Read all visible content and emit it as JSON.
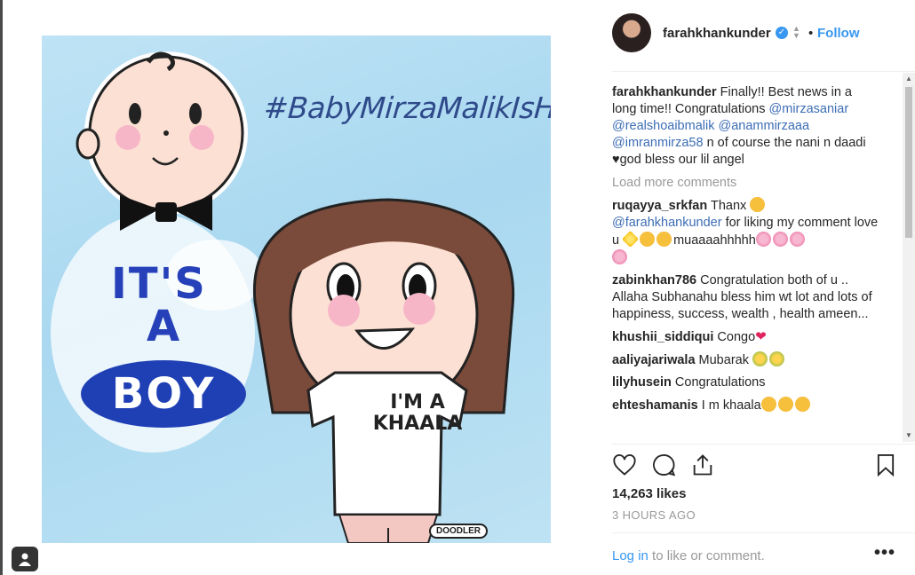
{
  "post": {
    "hashtag_art_text": "#BabyMirzaMalikIsHere",
    "art_its": "IT'S",
    "art_a": "A",
    "art_boy": "BOY",
    "art_shirt": "I'M A KHAALA",
    "art_signature": "DOODLER"
  },
  "header": {
    "username": "farahkhankunder",
    "follow_label": "Follow",
    "separator": "•"
  },
  "caption": {
    "username": "farahkhankunder",
    "text": " Finally!! Best news in a long time!! Congratulations ",
    "mention1": "@mirzasaniar",
    "sp1": " ",
    "mention2": "@realshoaibmalik",
    "sp2": " ",
    "mention3": "@anammirzaaa",
    "sp3": " ",
    "mention4": "@imranmirza58",
    "text2": " n of course the nani n daadi ",
    "heart": "♥",
    "text3": "god bless our lil angel"
  },
  "load_more": "Load more comments",
  "comments": [
    {
      "user": "ruqayya_srkfan",
      "text": " Thanx ",
      "mention": "@farahkhankunder",
      "text2": " for liking my comment love u ",
      "text3": "muaaaahhhhh"
    },
    {
      "user": "zabinkhan786",
      "text": " Congratulation both of u .. Allaha Subhanahu bless him wt lot and lots of happiness, success, wealth , health ameen..."
    },
    {
      "user": "khushii_siddiqui",
      "text": " Congo"
    },
    {
      "user": "aaliyajariwala",
      "text": " Mubarak "
    },
    {
      "user": "lilyhusein",
      "text": " Congratulations"
    },
    {
      "user": "ehteshamanis",
      "text": " I m khaala"
    }
  ],
  "likes": "14,263 likes",
  "time": "3 HOURS AGO",
  "login": {
    "link": "Log in",
    "rest": " to like or comment."
  },
  "more_label": "•••",
  "icons": [
    "heart-icon",
    "comment-icon",
    "share-icon",
    "bookmark-icon",
    "verified-icon",
    "avatar"
  ],
  "colors": {
    "link": "#3897f0",
    "mention": "#3d6db5",
    "muted": "#999999",
    "text": "#262626"
  }
}
